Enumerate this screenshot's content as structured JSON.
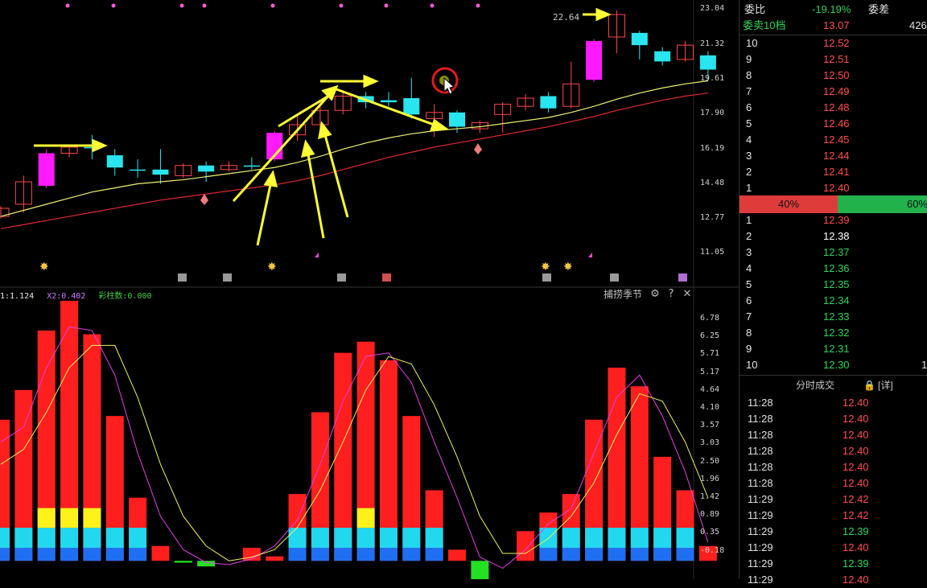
{
  "price_axis": [
    "23.04",
    "21.32",
    "19.61",
    "17.90",
    "16.19",
    "14.48",
    "12.77",
    "11.05"
  ],
  "high_label": "22.64",
  "indicator": {
    "x1": "1:1.124",
    "x2": "X2:0.402",
    "caizhu": "彩柱数:0.000",
    "title": "捕捞季节",
    "axis": [
      "6.78",
      "6.25",
      "5.71",
      "5.17",
      "4.64",
      "4.10",
      "3.57",
      "3.03",
      "2.50",
      "1.96",
      "1.42",
      "0.89",
      "0.35",
      "-0.18"
    ]
  },
  "order_book": {
    "weibi_label": "委比",
    "weibi_value": "-19.19%",
    "weicha_label": "委差",
    "sell10_label": "委卖10档",
    "sell10_value": "13.07",
    "sell10_extra": "426",
    "sells": [
      {
        "level": "10",
        "price": "12.52"
      },
      {
        "level": "9",
        "price": "12.51"
      },
      {
        "level": "8",
        "price": "12.50"
      },
      {
        "level": "7",
        "price": "12.49"
      },
      {
        "level": "6",
        "price": "12.48"
      },
      {
        "level": "5",
        "price": "12.46"
      },
      {
        "level": "4",
        "price": "12.45"
      },
      {
        "level": "3",
        "price": "12.44"
      },
      {
        "level": "2",
        "price": "12.41"
      },
      {
        "level": "1",
        "price": "12.40"
      }
    ],
    "sell_ratio": "40%",
    "buy_ratio": "60%",
    "buys": [
      {
        "level": "1",
        "price": "12.39"
      },
      {
        "level": "2",
        "price": "12.38"
      },
      {
        "level": "3",
        "price": "12.37"
      },
      {
        "level": "4",
        "price": "12.36"
      },
      {
        "level": "5",
        "price": "12.35"
      },
      {
        "level": "6",
        "price": "12.34"
      },
      {
        "level": "7",
        "price": "12.33"
      },
      {
        "level": "8",
        "price": "12.32"
      },
      {
        "level": "9",
        "price": "12.31"
      },
      {
        "level": "10",
        "price": "12.30"
      }
    ],
    "buy10_extra": "1",
    "colors": {
      "up": "#ff4d4d",
      "down": "#2fd35b",
      "neutral": "#ffffff"
    }
  },
  "trades_header": {
    "title": "分时成交",
    "detail": "[详]"
  },
  "trades": [
    {
      "time": "11:28",
      "price": "12.40"
    },
    {
      "time": "11:28",
      "price": "12.40"
    },
    {
      "time": "11:28",
      "price": "12.40"
    },
    {
      "time": "11:28",
      "price": "12.40"
    },
    {
      "time": "11:28",
      "price": "12.40"
    },
    {
      "time": "11:28",
      "price": "12.40"
    },
    {
      "time": "11:29",
      "price": "12.42"
    },
    {
      "time": "11:29",
      "price": "12.42"
    },
    {
      "time": "11:29",
      "price": "12.39"
    },
    {
      "time": "11:29",
      "price": "12.40"
    },
    {
      "time": "11:29",
      "price": "12.39"
    },
    {
      "time": "11:29",
      "price": "12.40"
    }
  ],
  "chart_data": [
    {
      "type": "candlestick",
      "y_axis_ticks": [
        23.04,
        21.32,
        19.61,
        17.9,
        16.19,
        14.48,
        12.77,
        11.05
      ],
      "ylim": [
        11.05,
        23.04
      ],
      "candles": [
        {
          "o": 12.9,
          "c": 13.3,
          "h": 13.4,
          "l": 12.8
        },
        {
          "o": 13.5,
          "c": 14.6,
          "h": 14.9,
          "l": 13.1
        },
        {
          "o": 14.4,
          "c": 16.0,
          "h": 16.2,
          "l": 14.3
        },
        {
          "o": 16.0,
          "c": 16.3,
          "h": 16.4,
          "l": 15.8
        },
        {
          "o": 16.3,
          "c": 16.25,
          "h": 16.9,
          "l": 15.7
        },
        {
          "o": 15.9,
          "c": 15.3,
          "h": 16.2,
          "l": 14.9
        },
        {
          "o": 15.2,
          "c": 15.15,
          "h": 15.7,
          "l": 14.8
        },
        {
          "o": 15.2,
          "c": 14.95,
          "h": 16.2,
          "l": 14.5
        },
        {
          "o": 14.9,
          "c": 15.4,
          "h": 15.5,
          "l": 14.8
        },
        {
          "o": 15.4,
          "c": 15.1,
          "h": 15.6,
          "l": 14.6
        },
        {
          "o": 15.2,
          "c": 15.4,
          "h": 15.6,
          "l": 15.1
        },
        {
          "o": 15.4,
          "c": 15.38,
          "h": 15.8,
          "l": 15.2
        },
        {
          "o": 15.7,
          "c": 17.0,
          "h": 17.1,
          "l": 15.6
        },
        {
          "o": 16.9,
          "c": 17.4,
          "h": 17.9,
          "l": 16.6
        },
        {
          "o": 17.4,
          "c": 18.1,
          "h": 18.5,
          "l": 17.2
        },
        {
          "o": 18.1,
          "c": 18.8,
          "h": 19.1,
          "l": 17.9
        },
        {
          "o": 18.8,
          "c": 18.5,
          "h": 19.0,
          "l": 18.2
        },
        {
          "o": 18.6,
          "c": 18.5,
          "h": 19.0,
          "l": 18.3
        },
        {
          "o": 18.7,
          "c": 17.9,
          "h": 19.7,
          "l": 17.7
        },
        {
          "o": 17.7,
          "c": 18.0,
          "h": 18.4,
          "l": 16.8
        },
        {
          "o": 18.0,
          "c": 17.3,
          "h": 18.1,
          "l": 17.0
        },
        {
          "o": 17.2,
          "c": 17.5,
          "h": 17.6,
          "l": 17.0
        },
        {
          "o": 17.9,
          "c": 18.4,
          "h": 18.5,
          "l": 17.0
        },
        {
          "o": 18.3,
          "c": 18.7,
          "h": 18.9,
          "l": 18.1
        },
        {
          "o": 18.8,
          "c": 18.2,
          "h": 19.0,
          "l": 18.0
        },
        {
          "o": 18.3,
          "c": 19.4,
          "h": 20.5,
          "l": 18.2
        },
        {
          "o": 21.5,
          "c": 19.6,
          "h": 21.6,
          "l": 19.5
        },
        {
          "o": 21.7,
          "c": 22.8,
          "h": 23.0,
          "l": 20.9
        },
        {
          "o": 21.9,
          "c": 21.3,
          "h": 22.0,
          "l": 20.6
        },
        {
          "o": 21.0,
          "c": 20.5,
          "h": 21.2,
          "l": 20.3
        },
        {
          "o": 20.6,
          "c": 21.3,
          "h": 21.5,
          "l": 20.5
        },
        {
          "o": 20.8,
          "c": 20.1,
          "h": 21.0,
          "l": 19.6
        }
      ],
      "ma_series": [
        {
          "values": [
            12.9,
            13.2,
            13.5,
            13.8,
            14.1,
            14.3,
            14.5,
            14.6,
            14.7,
            14.85,
            15.0,
            15.15,
            15.3,
            15.55,
            15.85,
            16.2,
            16.5,
            16.75,
            16.95,
            17.1,
            17.2,
            17.3,
            17.45,
            17.6,
            17.75,
            18.0,
            18.3,
            18.65,
            18.95,
            19.2,
            19.4,
            19.55
          ]
        },
        {
          "values": [
            12.3,
            12.5,
            12.7,
            12.9,
            13.1,
            13.3,
            13.5,
            13.7,
            13.85,
            14.0,
            14.15,
            14.3,
            14.45,
            14.65,
            14.9,
            15.2,
            15.5,
            15.8,
            16.05,
            16.3,
            16.5,
            16.7,
            16.9,
            17.1,
            17.3,
            17.55,
            17.8,
            18.1,
            18.35,
            18.6,
            18.8,
            18.95
          ]
        }
      ]
    },
    {
      "type": "bar",
      "y_axis_ticks": [
        6.78,
        6.25,
        5.71,
        5.17,
        4.64,
        4.1,
        3.57,
        3.03,
        2.5,
        1.96,
        1.42,
        0.89,
        0.35,
        -0.18
      ],
      "ylim": [
        -0.45,
        7.0
      ],
      "values": [
        3.8,
        4.6,
        6.2,
        7.0,
        6.1,
        3.9,
        1.7,
        0.4,
        -0.05,
        -0.15,
        0.0,
        0.35,
        0.12,
        1.8,
        4.0,
        5.6,
        5.9,
        5.4,
        3.9,
        1.9,
        0.3,
        -0.6,
        0.0,
        0.8,
        1.3,
        1.8,
        3.8,
        5.2,
        4.7,
        2.8,
        1.9,
        0.4
      ],
      "line_x1": [
        3.2,
        3.6,
        5.2,
        6.3,
        6.2,
        5.0,
        2.9,
        1.2,
        0.3,
        -0.05,
        -0.1,
        0.05,
        0.4,
        1.1,
        2.6,
        4.3,
        5.5,
        5.6,
        4.8,
        3.2,
        1.7,
        0.1,
        -0.2,
        0.3,
        1.0,
        1.4,
        2.9,
        4.4,
        5.0,
        3.9,
        2.4,
        0.5
      ],
      "line_x2": [
        2.6,
        3.0,
        4.0,
        5.2,
        5.8,
        5.8,
        4.4,
        2.6,
        1.2,
        0.4,
        0.0,
        0.1,
        0.3,
        0.9,
        1.9,
        3.2,
        4.6,
        5.5,
        5.3,
        4.2,
        2.8,
        1.2,
        0.2,
        0.2,
        0.6,
        1.2,
        2.1,
        3.4,
        4.5,
        4.3,
        3.2,
        1.7
      ]
    }
  ]
}
